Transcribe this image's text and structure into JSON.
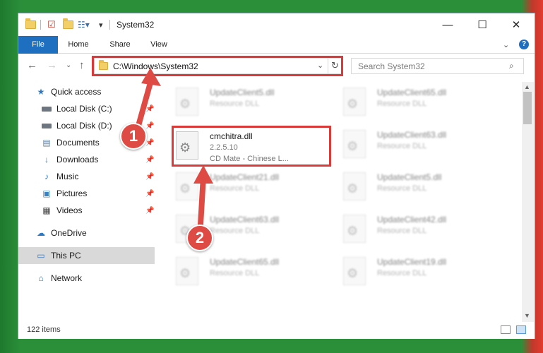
{
  "window": {
    "title": "System32"
  },
  "ribbon": {
    "tabs": [
      {
        "label": "File"
      },
      {
        "label": "Home"
      },
      {
        "label": "Share"
      },
      {
        "label": "View"
      }
    ]
  },
  "address": {
    "path": "C:\\Windows\\System32"
  },
  "search": {
    "placeholder": "Search System32"
  },
  "sidebar": {
    "items": [
      {
        "label": "Quick access",
        "icon": "star-icon"
      },
      {
        "label": "Local Disk (C:)",
        "icon": "drive-icon",
        "pinned": true
      },
      {
        "label": "Local Disk (D:)",
        "icon": "drive-icon",
        "pinned": true
      },
      {
        "label": "Documents",
        "icon": "documents-icon",
        "pinned": true
      },
      {
        "label": "Downloads",
        "icon": "downloads-icon",
        "pinned": true
      },
      {
        "label": "Music",
        "icon": "music-icon",
        "pinned": true
      },
      {
        "label": "Pictures",
        "icon": "pictures-icon",
        "pinned": true
      },
      {
        "label": "Videos",
        "icon": "videos-icon",
        "pinned": true
      },
      {
        "label": "OneDrive",
        "icon": "cloud-icon"
      },
      {
        "label": "This PC",
        "icon": "computer-icon",
        "selected": true
      },
      {
        "label": "Network",
        "icon": "network-icon"
      }
    ]
  },
  "files": {
    "left": [
      {
        "name": "UpdateClient5.dll",
        "desc": "Resource DLL"
      },
      {
        "name": "cmchitra.dll",
        "version": "2.2.5.10",
        "desc": "CD Mate - Chinese L..."
      },
      {
        "name": "UpdateClient21.dll",
        "desc": "Resource DLL"
      },
      {
        "name": "UpdateClient63.dll",
        "desc": "Resource DLL"
      },
      {
        "name": "UpdateClient65.dll",
        "desc": "Resource DLL"
      }
    ],
    "right": [
      {
        "name": "UpdateClient65.dll",
        "desc": "Resource DLL"
      },
      {
        "name": "UpdateClient63.dll",
        "desc": "Resource DLL"
      },
      {
        "name": "UpdateClient5.dll",
        "desc": "Resource DLL"
      },
      {
        "name": "UpdateClient42.dll",
        "desc": "Resource DLL"
      },
      {
        "name": "UpdateClient19.dll",
        "desc": "Resource DLL"
      }
    ]
  },
  "status": {
    "item_count": "122 items"
  },
  "callouts": {
    "one": "1",
    "two": "2"
  },
  "colors": {
    "accent": "#1f6fc0",
    "highlight": "#d93a3a",
    "callout": "#dd4b44"
  }
}
